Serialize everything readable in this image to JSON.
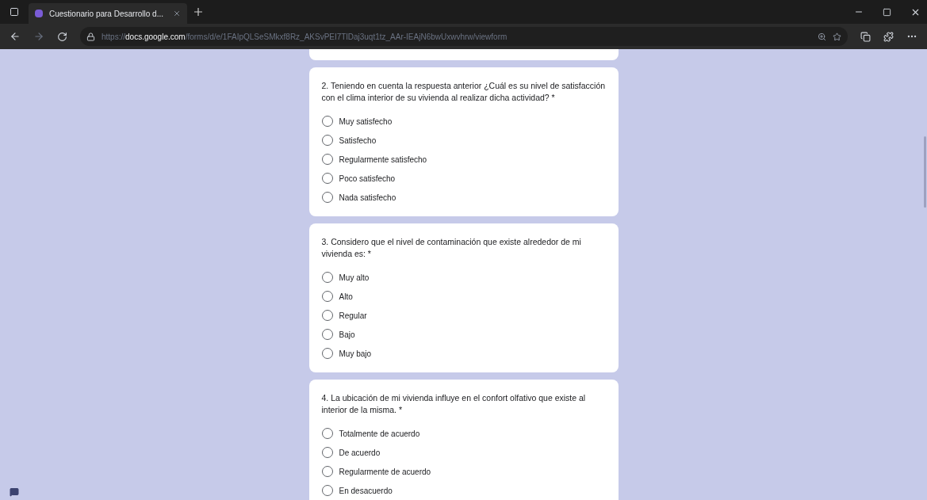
{
  "browser": {
    "tab_title": "Cuestionario para Desarrollo d...",
    "url_prefix": "https://",
    "url_domain": "docs.google.com",
    "url_path": "/forms/d/e/1FAIpQLSeSMkxf8Rz_AKSvPEI7TlDaj3uqt1tz_AAr-IEAjN6bwUxwvhrw/viewform"
  },
  "questions": [
    {
      "title": "2. Teniendo en cuenta la respuesta anterior ¿Cuál es su nivel de satisfacción con el clima interior de su vivienda al realizar dicha actividad? *",
      "options": [
        {
          "label": "Muy satisfecho",
          "selected": false
        },
        {
          "label": "Satisfecho",
          "selected": false
        },
        {
          "label": "Regularmente satisfecho",
          "selected": false
        },
        {
          "label": "Poco satisfecho",
          "selected": false
        },
        {
          "label": "Nada satisfecho",
          "selected": false
        }
      ]
    },
    {
      "title": "3. Considero que el nivel de contaminación que existe alrededor de mi vivienda es: *",
      "options": [
        {
          "label": "Muy alto",
          "selected": false
        },
        {
          "label": "Alto",
          "selected": false
        },
        {
          "label": "Regular",
          "selected": false
        },
        {
          "label": "Bajo",
          "selected": false
        },
        {
          "label": "Muy bajo",
          "selected": false
        }
      ]
    },
    {
      "title": "4. La ubicación de mi vivienda influye en el confort olfativo que existe al interior de la misma. *",
      "options": [
        {
          "label": "Totalmente de acuerdo",
          "selected": false
        },
        {
          "label": "De acuerdo",
          "selected": false
        },
        {
          "label": "Regularmente de acuerdo",
          "selected": false
        },
        {
          "label": "En desacuerdo",
          "selected": false
        }
      ]
    }
  ]
}
